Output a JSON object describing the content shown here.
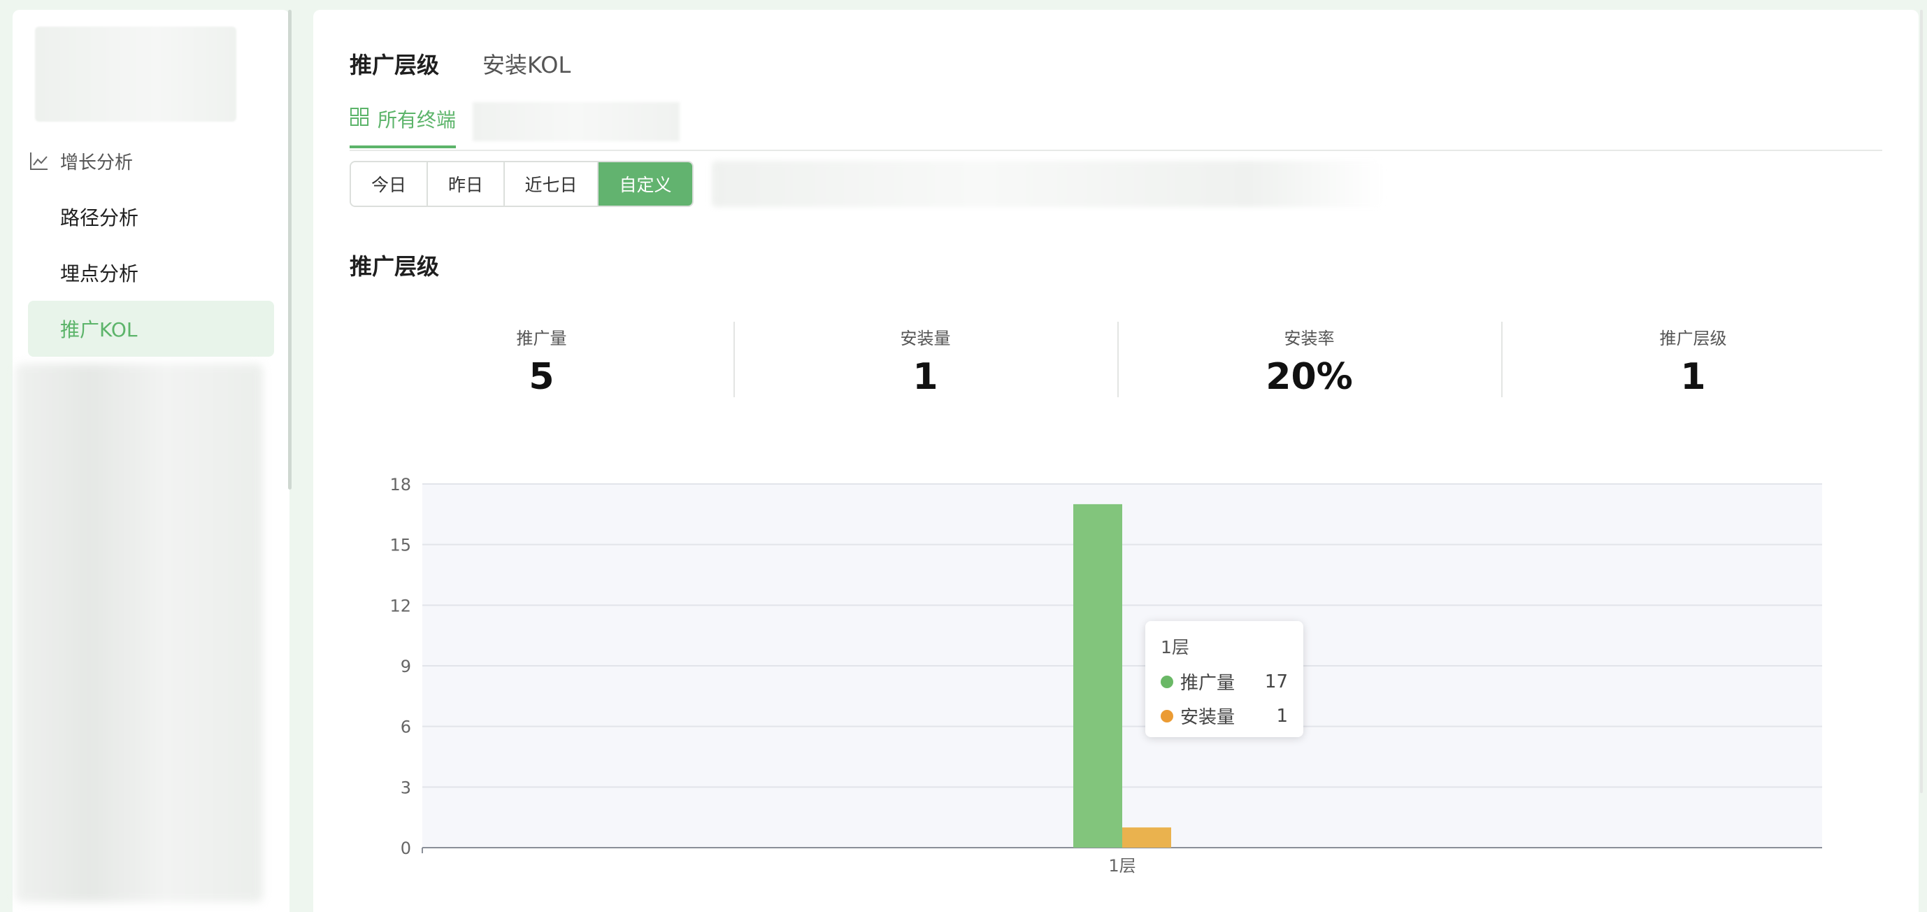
{
  "sidebar": {
    "group_label": "增长分析",
    "items": [
      {
        "label": "路径分析",
        "active": false
      },
      {
        "label": "埋点分析",
        "active": false
      },
      {
        "label": "推广KOL",
        "active": true
      }
    ]
  },
  "main": {
    "top_tabs": [
      {
        "label": "推广层级",
        "active": true
      },
      {
        "label": "安装KOL",
        "active": false
      }
    ],
    "terminal_tab": {
      "label": "所有终端",
      "icon": "grid-icon"
    },
    "date_ranges": [
      {
        "label": "今日",
        "active": false
      },
      {
        "label": "昨日",
        "active": false
      },
      {
        "label": "近七日",
        "active": false
      },
      {
        "label": "自定义",
        "active": true
      }
    ],
    "section_title": "推广层级",
    "stats": [
      {
        "label": "推广量",
        "value": "5"
      },
      {
        "label": "安装量",
        "value": "1"
      },
      {
        "label": "安装率",
        "value": "20%"
      },
      {
        "label": "推广层级",
        "value": "1"
      }
    ]
  },
  "colors": {
    "accent": "#5cb46a",
    "series_promo": "#82c57c",
    "series_install": "#eab24e"
  },
  "chart_data": {
    "type": "bar",
    "categories": [
      "1层"
    ],
    "series": [
      {
        "name": "推广量",
        "values": [
          17
        ]
      },
      {
        "name": "安装量",
        "values": [
          1
        ]
      }
    ],
    "ylim": [
      0,
      18
    ],
    "yticks": [
      0,
      3,
      6,
      9,
      12,
      15,
      18
    ],
    "grid": true
  },
  "tooltip": {
    "title": "1层",
    "rows": [
      {
        "name": "推广量",
        "value": "17"
      },
      {
        "name": "安装量",
        "value": "1"
      }
    ]
  }
}
